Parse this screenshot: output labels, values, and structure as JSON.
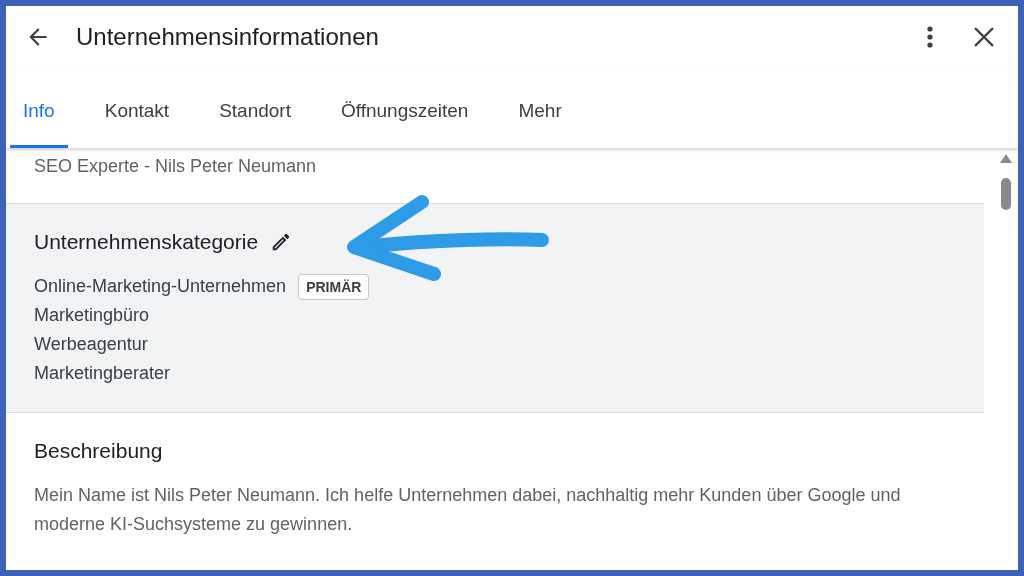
{
  "header": {
    "title": "Unternehmensinformationen"
  },
  "tabs": [
    {
      "label": "Info",
      "selected": true
    },
    {
      "label": "Kontakt",
      "selected": false
    },
    {
      "label": "Standort",
      "selected": false
    },
    {
      "label": "Öffnungszeiten",
      "selected": false
    },
    {
      "label": "Mehr",
      "selected": false
    }
  ],
  "business_name": "SEO Experte - Nils Peter Neumann",
  "category_section": {
    "heading": "Unternehmenskategorie",
    "categories": [
      {
        "name": "Online-Marketing-Unternehmen",
        "badge": "PRIMÄR"
      },
      {
        "name": "Marketingbüro"
      },
      {
        "name": "Werbeagentur"
      },
      {
        "name": "Marketingberater"
      }
    ]
  },
  "description_section": {
    "heading": "Beschreibung",
    "text": "Mein Name ist Nils Peter Neumann. Ich helfe Unternehmen dabei, nachhaltig mehr Kunden über Google und moderne KI-Suchsysteme zu gewinnen."
  }
}
